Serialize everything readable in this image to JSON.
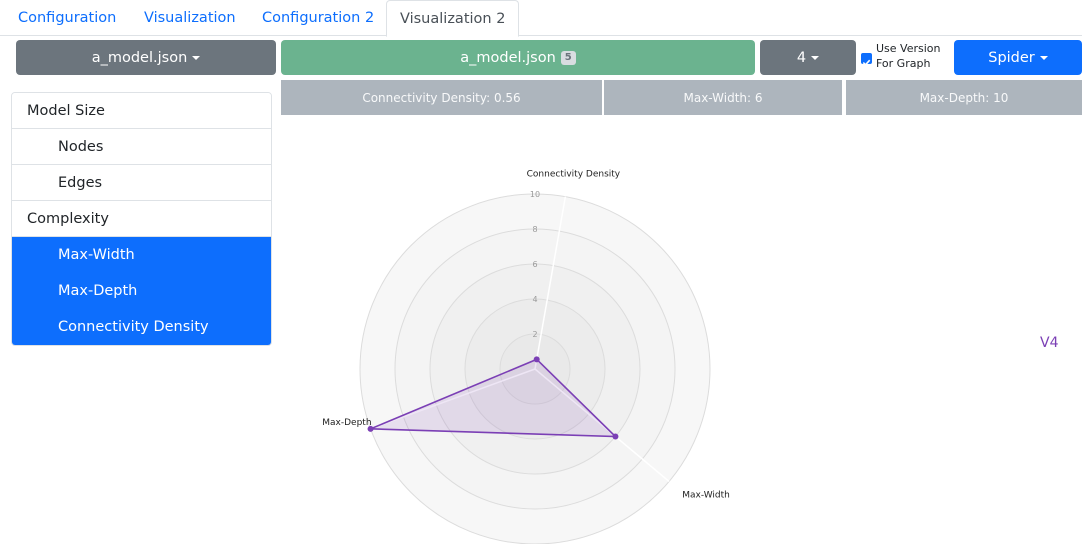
{
  "tabs": [
    {
      "label": "Configuration",
      "active": false
    },
    {
      "label": "Visualization",
      "active": false
    },
    {
      "label": "Configuration 2",
      "active": false
    },
    {
      "label": "Visualization 2",
      "active": true
    }
  ],
  "toolbar": {
    "file_dropdown": "a_model.json",
    "file_button": "a_model.json",
    "file_badge": "5",
    "version_dropdown": "4",
    "use_version_line1": "Use Version",
    "use_version_line2": "For Graph",
    "use_version_checked": true,
    "chart_type_dropdown": "Spider"
  },
  "stats": {
    "connectivity_density": "Connectivity Density: 0.56",
    "max_width": "Max-Width: 6",
    "max_depth": "Max-Depth: 10"
  },
  "sidebar": {
    "items": [
      {
        "label": "Model Size",
        "level": 0,
        "active": false
      },
      {
        "label": "Nodes",
        "level": 1,
        "active": false
      },
      {
        "label": "Edges",
        "level": 1,
        "active": false
      },
      {
        "label": "Complexity",
        "level": 0,
        "active": false
      },
      {
        "label": "Max-Width",
        "level": 1,
        "active": true
      },
      {
        "label": "Max-Depth",
        "level": 1,
        "active": true
      },
      {
        "label": "Connectivity Density",
        "level": 1,
        "active": true
      }
    ]
  },
  "legend_label": "V4",
  "colors": {
    "primary": "#0d6efd",
    "secondary": "#6c757d",
    "success": "#6bb38f",
    "stat_bg": "#adb5bd",
    "series": "#7b3fb5"
  },
  "chart_data": {
    "type": "radar",
    "axes": [
      "Connectivity Density",
      "Max-Width",
      "Max-Depth"
    ],
    "r_ticks": [
      "2",
      "4",
      "6",
      "8",
      "10"
    ],
    "r_range": [
      0,
      10
    ],
    "series": [
      {
        "name": "V4",
        "values": [
          0.56,
          6,
          10
        ]
      }
    ]
  }
}
